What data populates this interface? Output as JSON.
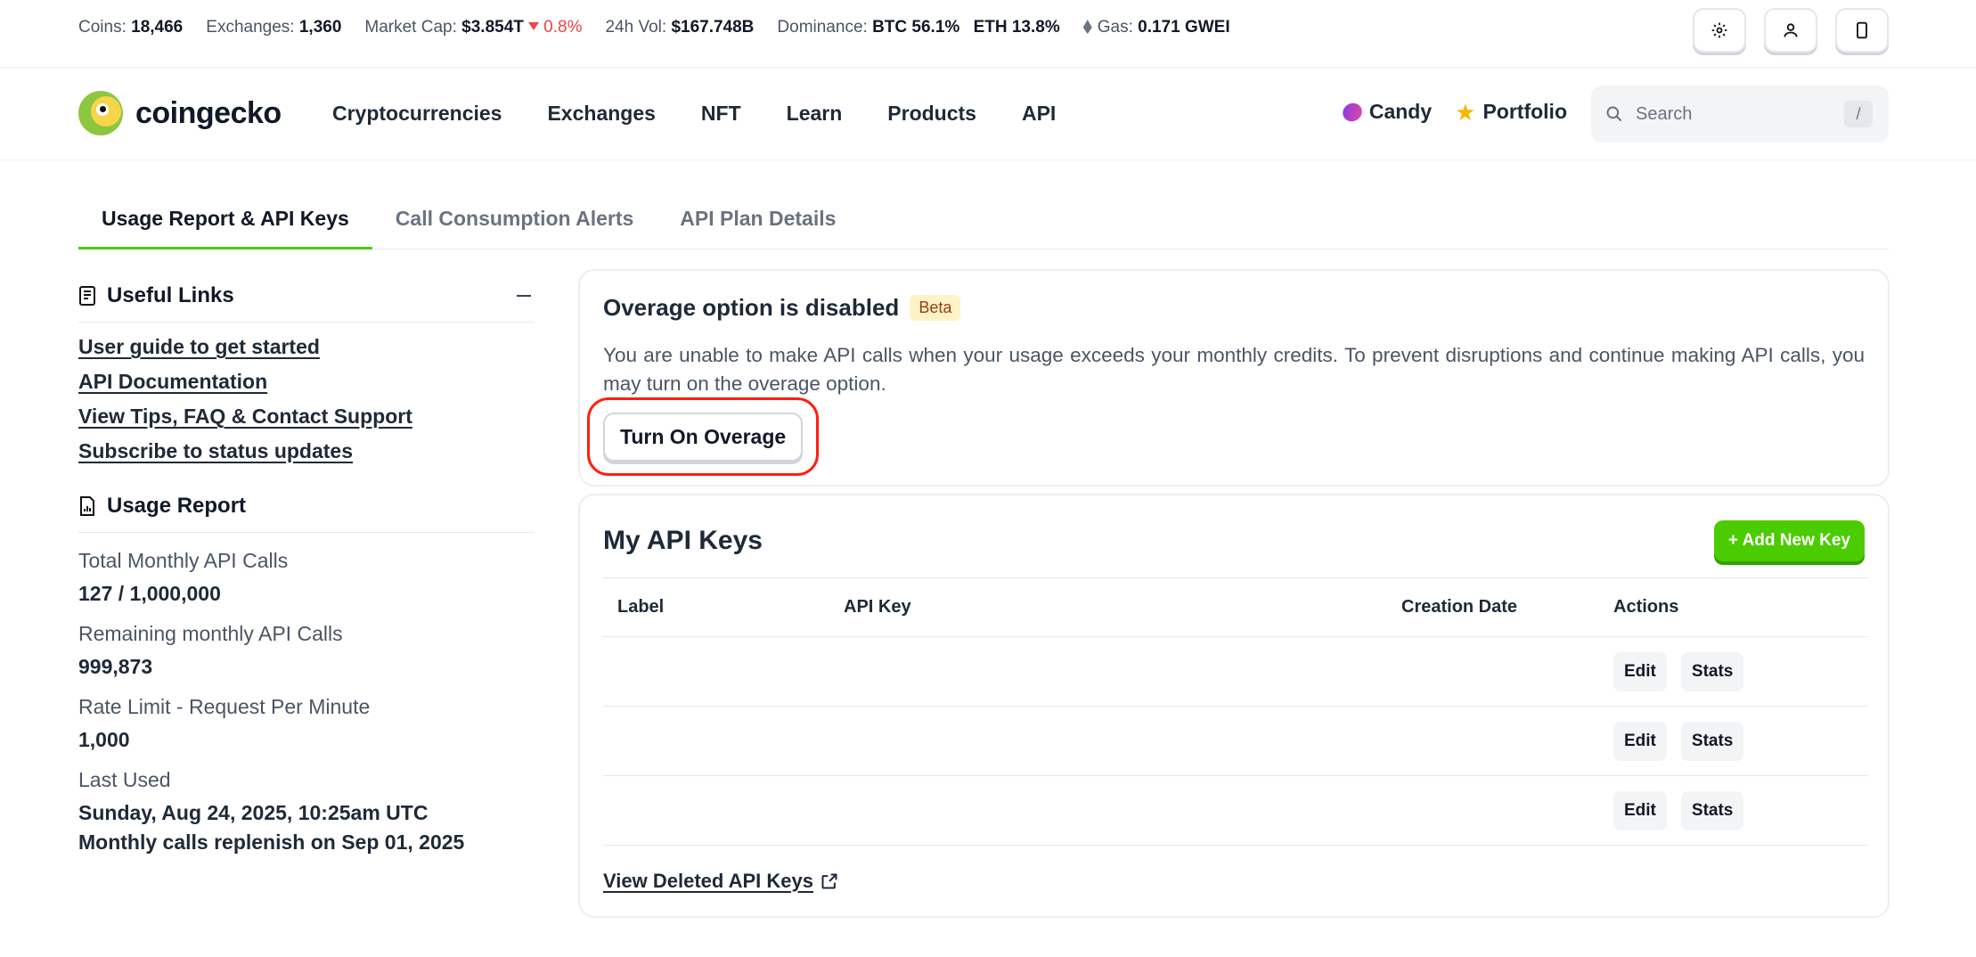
{
  "stats": {
    "coins_label": "Coins:",
    "coins": "18,466",
    "exchanges_label": "Exchanges:",
    "exchanges": "1,360",
    "market_cap_label": "Market Cap:",
    "market_cap": "$3.854T",
    "market_cap_change": "0.8%",
    "vol_label": "24h Vol:",
    "vol": "$167.748B",
    "dominance_label": "Dominance:",
    "btc": "BTC 56.1%",
    "eth": "ETH 13.8%",
    "gas_label": "Gas:",
    "gas": "0.171 GWEI"
  },
  "nav": {
    "logo": "coingecko",
    "menu": [
      "Cryptocurrencies",
      "Exchanges",
      "NFT",
      "Learn",
      "Products",
      "API"
    ],
    "candy": "Candy",
    "portfolio": "Portfolio",
    "search_placeholder": "Search",
    "search_shortcut": "/"
  },
  "tabs": [
    "Usage Report & API Keys",
    "Call Consumption Alerts",
    "API Plan Details"
  ],
  "sidebar": {
    "useful_links_title": "Useful Links",
    "links": [
      "User guide to get started",
      "API Documentation",
      "View Tips, FAQ & Contact Support",
      "Subscribe to status updates"
    ],
    "usage_title": "Usage Report",
    "metrics": [
      {
        "label": "Total Monthly API Calls",
        "value": "127 / 1,000,000"
      },
      {
        "label": "Remaining monthly API Calls",
        "value": "999,873"
      },
      {
        "label": "Rate Limit - Request Per Minute",
        "value": "1,000"
      }
    ],
    "last_used_label": "Last Used",
    "last_used_value": "Sunday, Aug 24, 2025, 10:25am UTC",
    "replenish": "Monthly calls replenish on Sep 01, 2025"
  },
  "overage": {
    "title": "Overage option is disabled",
    "badge": "Beta",
    "text": "You are unable to make API calls when your usage exceeds your monthly credits. To prevent disruptions and continue making API calls, you may turn on the overage option.",
    "button": "Turn On Overage"
  },
  "api_keys": {
    "title": "My API Keys",
    "add_button": "+ Add New Key",
    "columns": [
      "Label",
      "API Key",
      "Creation Date",
      "Actions"
    ],
    "edit_label": "Edit",
    "stats_label": "Stats",
    "deleted_link": "View Deleted API Keys"
  },
  "colors": {
    "accent": "#4bcc00",
    "negative": "#ef4444",
    "highlight": "#ff1f0f"
  }
}
